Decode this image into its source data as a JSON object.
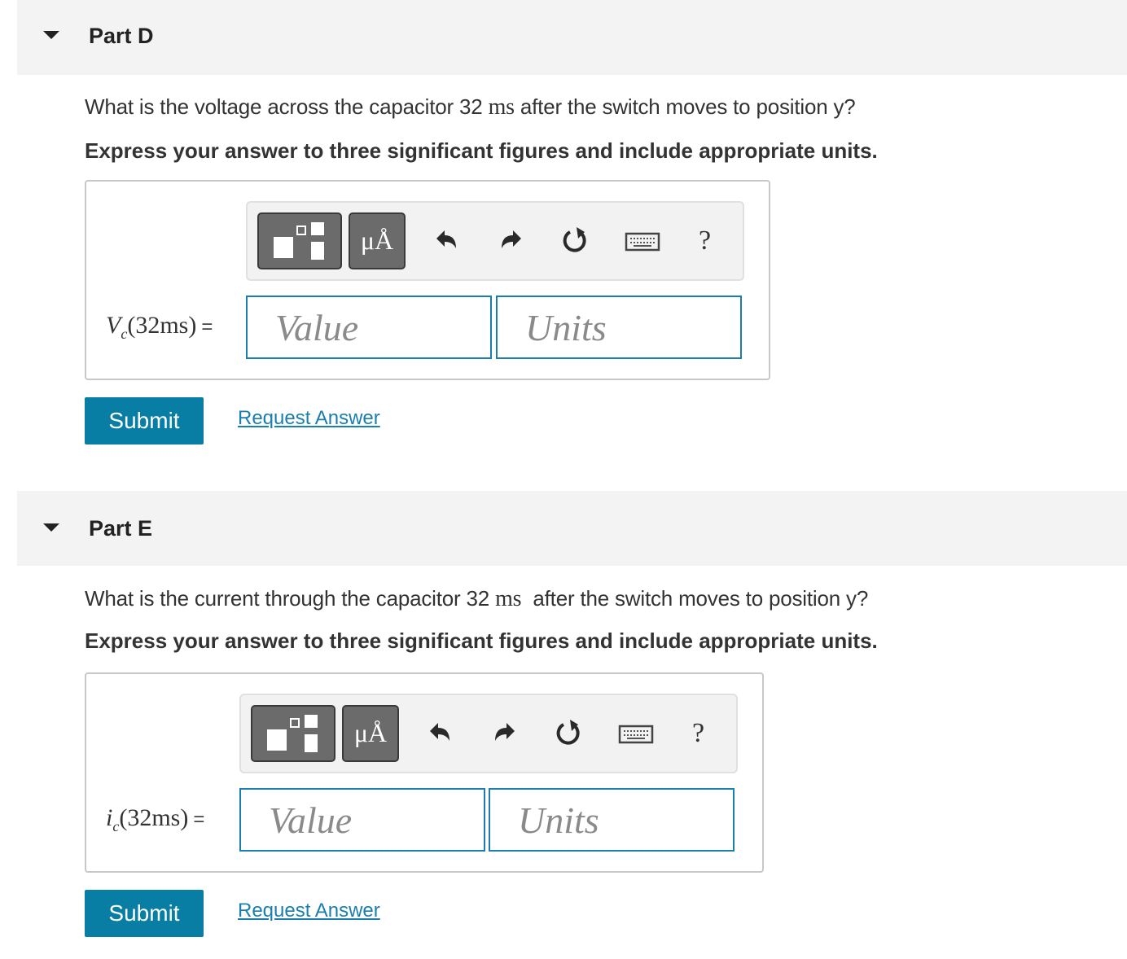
{
  "parts": [
    {
      "title": "Part D",
      "question_pre": "What is the voltage across the capacitor 32 ",
      "question_unit": "ms",
      "question_post": " after the switch moves to position y?",
      "instruction": "Express your answer to three significant figures and include appropriate units.",
      "var_name": "V",
      "var_sub": "c",
      "var_arg": "(32ms)",
      "equals": "=",
      "value_placeholder": "Value",
      "units_placeholder": "Units",
      "submit_label": "Submit",
      "request_label": "Request Answer"
    },
    {
      "title": "Part E",
      "question_pre": "What is the current through the capacitor 32 ",
      "question_unit": "ms",
      "question_post": "  after the switch moves to position y?",
      "instruction": "Express your answer to three significant figures and include appropriate units.",
      "var_name": "i",
      "var_sub": "c",
      "var_arg": "(32ms)",
      "equals": "=",
      "value_placeholder": "Value",
      "units_placeholder": "Units",
      "submit_label": "Submit",
      "request_label": "Request Answer"
    }
  ],
  "toolbar": {
    "units_symbol": "μÅ",
    "help_symbol": "?",
    "icons": [
      "templates-icon",
      "units-icon",
      "undo-icon",
      "redo-icon",
      "reset-icon",
      "keyboard-icon",
      "help-icon"
    ]
  },
  "colors": {
    "header_bg": "#f3f3f3",
    "accent": "#087ea4",
    "field_border": "#1c7db0",
    "link": "#1a7eb0",
    "toolbar_button": "#6b6b6b"
  }
}
